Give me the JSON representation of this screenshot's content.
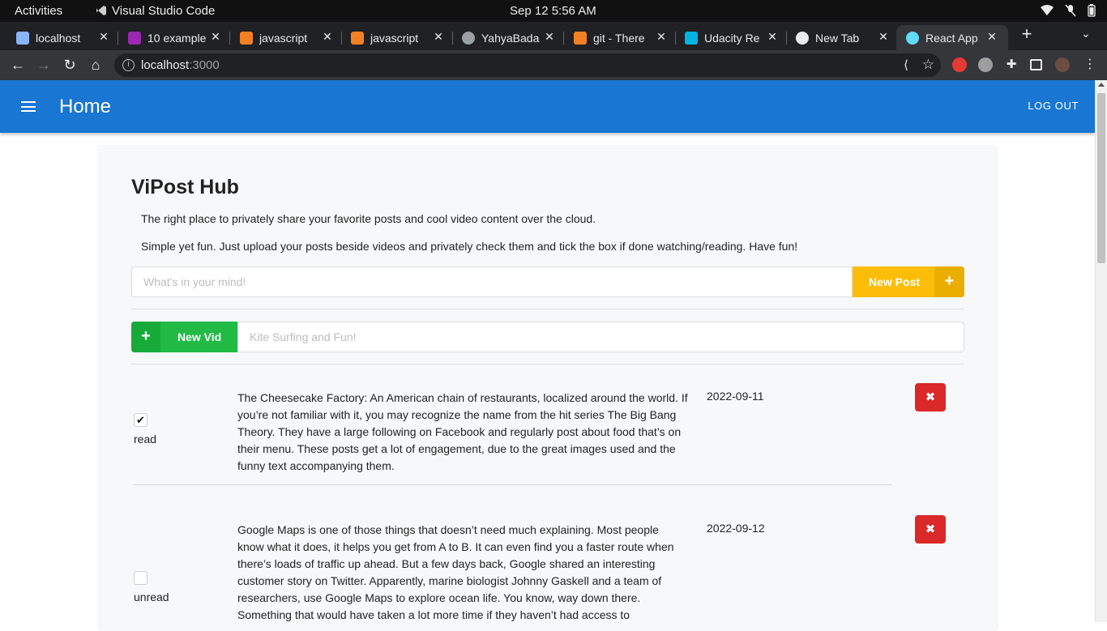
{
  "os": {
    "activities": "Activities",
    "app_name": "Visual Studio Code",
    "clock": "Sep 12   5:56 AM",
    "tray_icons": [
      "wifi-icon",
      "mic-muted-icon",
      "battery-icon"
    ]
  },
  "browser": {
    "tabs": [
      {
        "title": "localhost",
        "favicon": "#8ab4f8",
        "close": "✕"
      },
      {
        "title": "10 example",
        "favicon": "#9c27b0",
        "close": "✕"
      },
      {
        "title": "javascript",
        "favicon": "#f48024",
        "close": "✕"
      },
      {
        "title": "javascript",
        "favicon": "#f48024",
        "close": "✕"
      },
      {
        "title": "YahyaBada",
        "favicon": "#9aa0a6",
        "close": "✕"
      },
      {
        "title": "git - There",
        "favicon": "#f48024",
        "close": "✕"
      },
      {
        "title": "Udacity Re",
        "favicon": "#02b3e4",
        "close": "✕"
      },
      {
        "title": "New Tab",
        "favicon": "#e8eaed",
        "close": "✕"
      },
      {
        "title": "React App",
        "favicon": "#61dafb",
        "close": "✕",
        "active": true
      }
    ],
    "new_tab": "+",
    "tab_menu": "⌄",
    "url_host": "localhost",
    "url_port": ":3000",
    "nav": {
      "back": "←",
      "forward": "→",
      "reload": "↻",
      "home": "⌂"
    }
  },
  "appbar": {
    "title": "Home",
    "logout": "LOG OUT",
    "color": "#1976d2"
  },
  "hub": {
    "title": "ViPost Hub",
    "desc1": "The right place to privately share your favorite posts and cool video content over the cloud.",
    "desc2": "Simple yet fun. Just upload your posts beside videos and privately check them and tick the box if done watching/reading. Have fun!",
    "post_placeholder": "What's in your mind!",
    "new_post_label": "New Post",
    "new_post_icon": "+",
    "new_vid_label": "New Vid",
    "new_vid_icon": "+",
    "vid_placeholder": "Kite Surfing and Fun!"
  },
  "posts": [
    {
      "checked": true,
      "check_mark": "✔",
      "status": "read",
      "text": "The Cheesecake Factory: An American chain of restaurants, localized around the world. If you’re not familiar with it, you may recognize the name from the hit series The Big Bang Theory. They have a large following on Facebook and regularly post about food that’s on their menu. These posts get a lot of engagement, due to the great images used and the funny text accompanying them.",
      "date": "2022-09-11",
      "delete_icon": "✖"
    },
    {
      "checked": false,
      "check_mark": "",
      "status": "unread",
      "text": "Google Maps is one of those things that doesn’t need much explaining. Most people know what it does, it helps you get from A to B. It can even find you a faster route when there’s loads of traffic up ahead. But a few days back, Google shared an interesting customer story on Twitter. Apparently, marine biologist Johnny Gaskell and a team of researchers, use Google Maps to explore ocean life. You know, way down there. Something that would have taken a lot more time if they haven’t had access to",
      "date": "2022-09-12",
      "delete_icon": "✖"
    }
  ]
}
